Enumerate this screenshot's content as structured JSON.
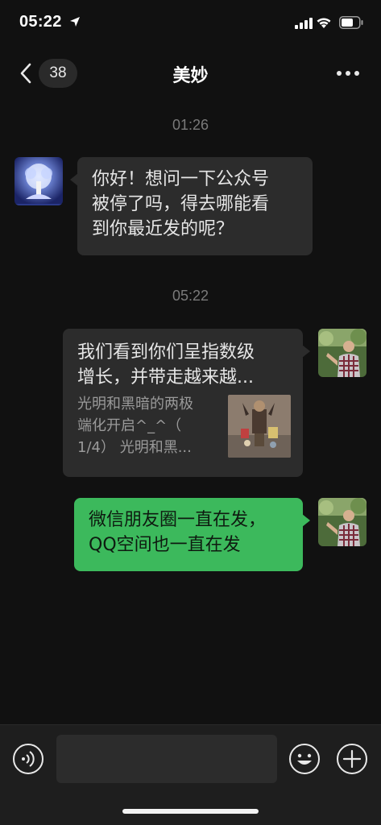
{
  "status_bar": {
    "time": "05:22",
    "location_icon": "location-arrow-icon",
    "signal_icon": "cellular-signal-icon",
    "wifi_icon": "wifi-icon",
    "battery_icon": "battery-icon"
  },
  "nav": {
    "back_icon": "chevron-left-icon",
    "unread_count": "38",
    "title": "美妙",
    "more_icon": "more-dots-icon"
  },
  "messages": [
    {
      "type": "timestamp",
      "text": "01:26"
    },
    {
      "type": "text",
      "direction": "incoming",
      "avatar": "tree-avatar",
      "lines": [
        "你好！想问一下公众号",
        "被停了吗，得去哪能看",
        "到你最近发的呢？"
      ]
    },
    {
      "type": "timestamp",
      "text": "05:22"
    },
    {
      "type": "link",
      "direction": "outgoing",
      "avatar": "person-avatar",
      "title_lines": [
        "我们看到你们呈指数级",
        "增长，并带走越来越..."
      ],
      "desc_lines": [
        "光明和黑暗的两极",
        "端化开启^_^（",
        "1/4） 光明和黑..."
      ],
      "thumbnail": "article-thumbnail"
    },
    {
      "type": "text",
      "direction": "outgoing",
      "avatar": "person-avatar",
      "lines": [
        "微信朋友圈一直在发，",
        "QQ空间也一直在发"
      ]
    }
  ],
  "input_bar": {
    "voice_icon": "voice-icon",
    "input_value": "",
    "input_placeholder": "",
    "emoji_icon": "emoji-icon",
    "plus_icon": "plus-icon"
  },
  "colors": {
    "background": "#111111",
    "incoming_bubble": "#2c2c2c",
    "outgoing_bubble": "#3cb95c",
    "timestamp": "#7a7a7a",
    "input_bar": "#1e1e1e"
  }
}
